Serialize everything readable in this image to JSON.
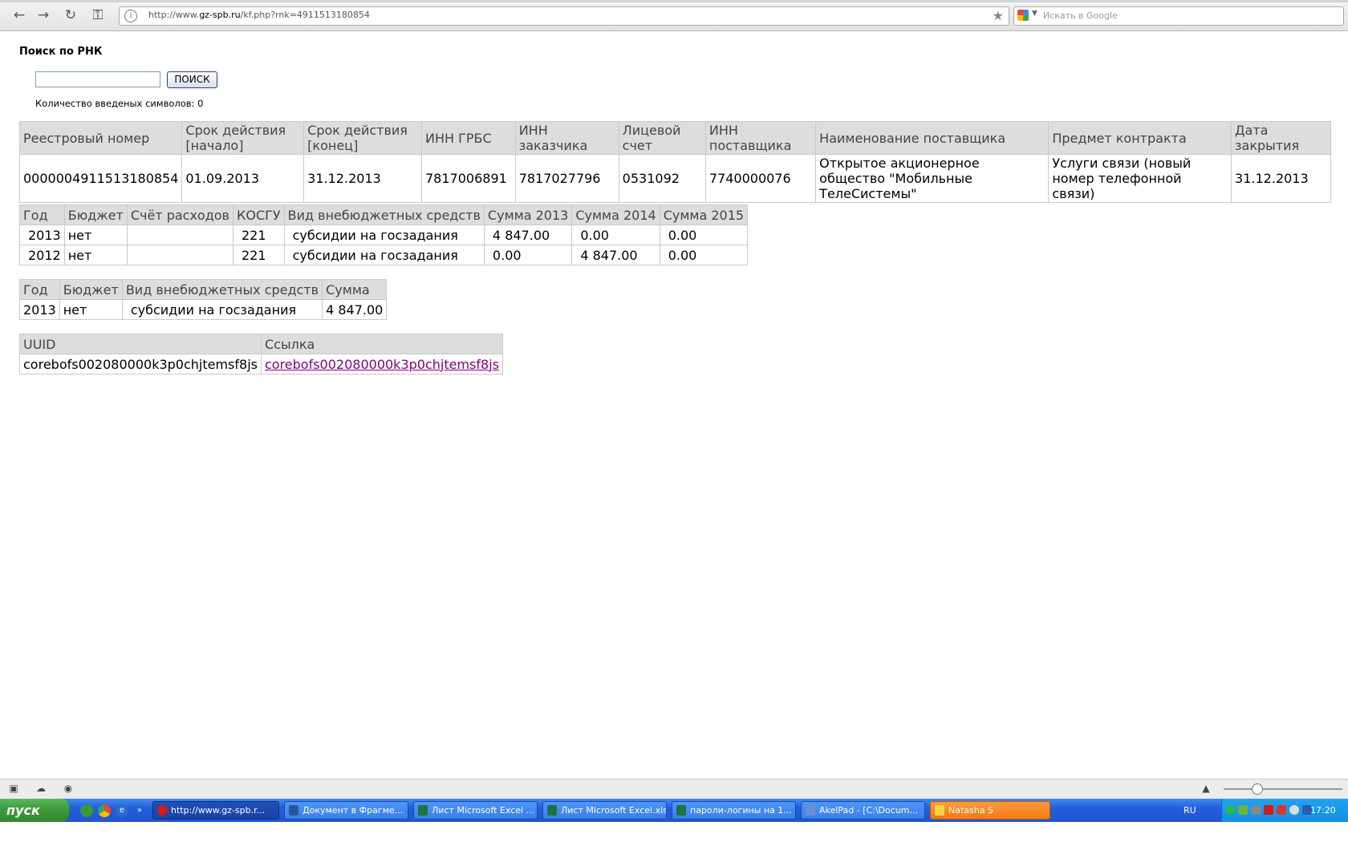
{
  "browser": {
    "url_prefix": "http://www.",
    "url_domain": "gz-spb.ru",
    "url_path": "/kf.php?rnk=4911513180854",
    "search_placeholder": "Искать в Google"
  },
  "page": {
    "title": "Поиск по РНК",
    "search_value": "",
    "search_button": "ПОИСК",
    "count_label": "Количество введеных символов: 0"
  },
  "contract_table": {
    "headers": [
      "Реестровый номер",
      "Срок действия [начало]",
      "Срок действия [конец]",
      "ИНН ГРБС",
      "ИНН заказчика",
      "Лицевой счет",
      "ИНН поставщика",
      "Наименование поставщика",
      "Предмет контракта",
      "Дата закрытия"
    ],
    "row": [
      "0000004911513180854",
      "01.09.2013",
      "31.12.2013",
      "7817006891",
      "7817027796",
      "0531092",
      "7740000076",
      "Открытое акционерное общество \"Мобильные ТелеСистемы\"",
      "Услуги связи (новый номер телефонной связи)",
      "31.12.2013"
    ]
  },
  "budget_table": {
    "headers": [
      "Год",
      "Бюджет",
      "Счёт расходов",
      "КОСГУ",
      "Вид внебюджетных средств",
      "Сумма 2013",
      "Сумма 2014",
      "Сумма 2015"
    ],
    "rows": [
      [
        "2013",
        "нет",
        "",
        "221",
        "субсидии на госзадания",
        "4 847.00",
        "0.00",
        "0.00"
      ],
      [
        "2012",
        "нет",
        "",
        "221",
        "субсидии на госзадания",
        "0.00",
        "4 847.00",
        "0.00"
      ]
    ]
  },
  "sum_table": {
    "headers": [
      "Год",
      "Бюджет",
      "Вид внебюджетных средств",
      "Сумма"
    ],
    "row": [
      "2013",
      "нет",
      "субсидии на госзадания",
      "4 847.00"
    ]
  },
  "uuid_table": {
    "headers": [
      "UUID",
      "Ссылка"
    ],
    "row": [
      "corebofs002080000k3p0chjtemsf8js",
      "corebofs002080000k3p0chjtemsf8js"
    ]
  },
  "taskbar": {
    "start_label": "пуск",
    "tasks": [
      {
        "label": "http://www.gz-spb.r...",
        "icon_color": "#d61a1a"
      },
      {
        "label": "Документ в Фрагме...",
        "icon_color": "#2b5797"
      },
      {
        "label": "Лист Microsoft Excel ...",
        "icon_color": "#1e7145"
      },
      {
        "label": "Лист Microsoft Excel.xls",
        "icon_color": "#1e7145"
      },
      {
        "label": "пароли-логины на 1...",
        "icon_color": "#1e7145"
      },
      {
        "label": "AkelPad - [C:\\Docum...",
        "icon_color": "#6a8fd8"
      },
      {
        "label": "Natasha S",
        "icon_color": "#f7d64a"
      }
    ],
    "lang": "RU",
    "clock": "17:20"
  }
}
